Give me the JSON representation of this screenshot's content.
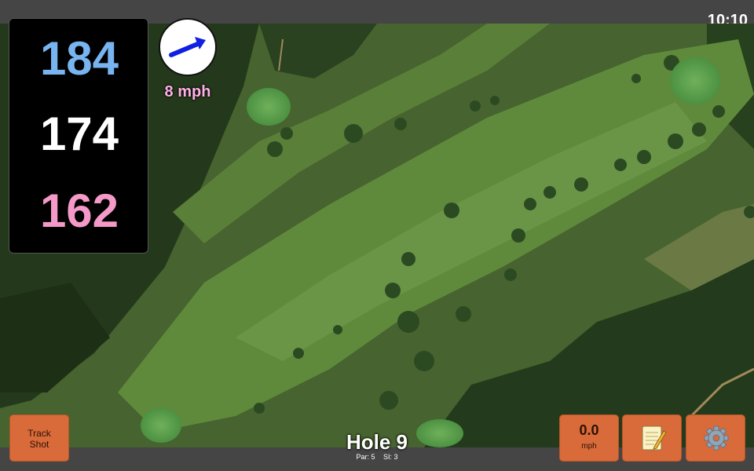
{
  "status_bar": {
    "time": "10:10"
  },
  "distances": {
    "back": "184",
    "center": "174",
    "front": "162"
  },
  "wind": {
    "speed_label": "8 mph",
    "icon": "wind-direction-arrow-icon"
  },
  "buttons": {
    "track_shot_line1": "Track",
    "track_shot_line2": "Shot",
    "speed_value": "0.0",
    "speed_unit": "mph",
    "notes_icon": "notepad-icon",
    "settings_icon": "gear-icon"
  },
  "hole": {
    "title": "Hole 9",
    "par": "Par: 5",
    "si": "SI: 3"
  },
  "colors": {
    "back_distance": "#78b4f0",
    "center_distance": "#ffffff",
    "front_distance": "#f59ac8",
    "button": "#d96a3a",
    "wind_label": "#ffb0e6"
  }
}
